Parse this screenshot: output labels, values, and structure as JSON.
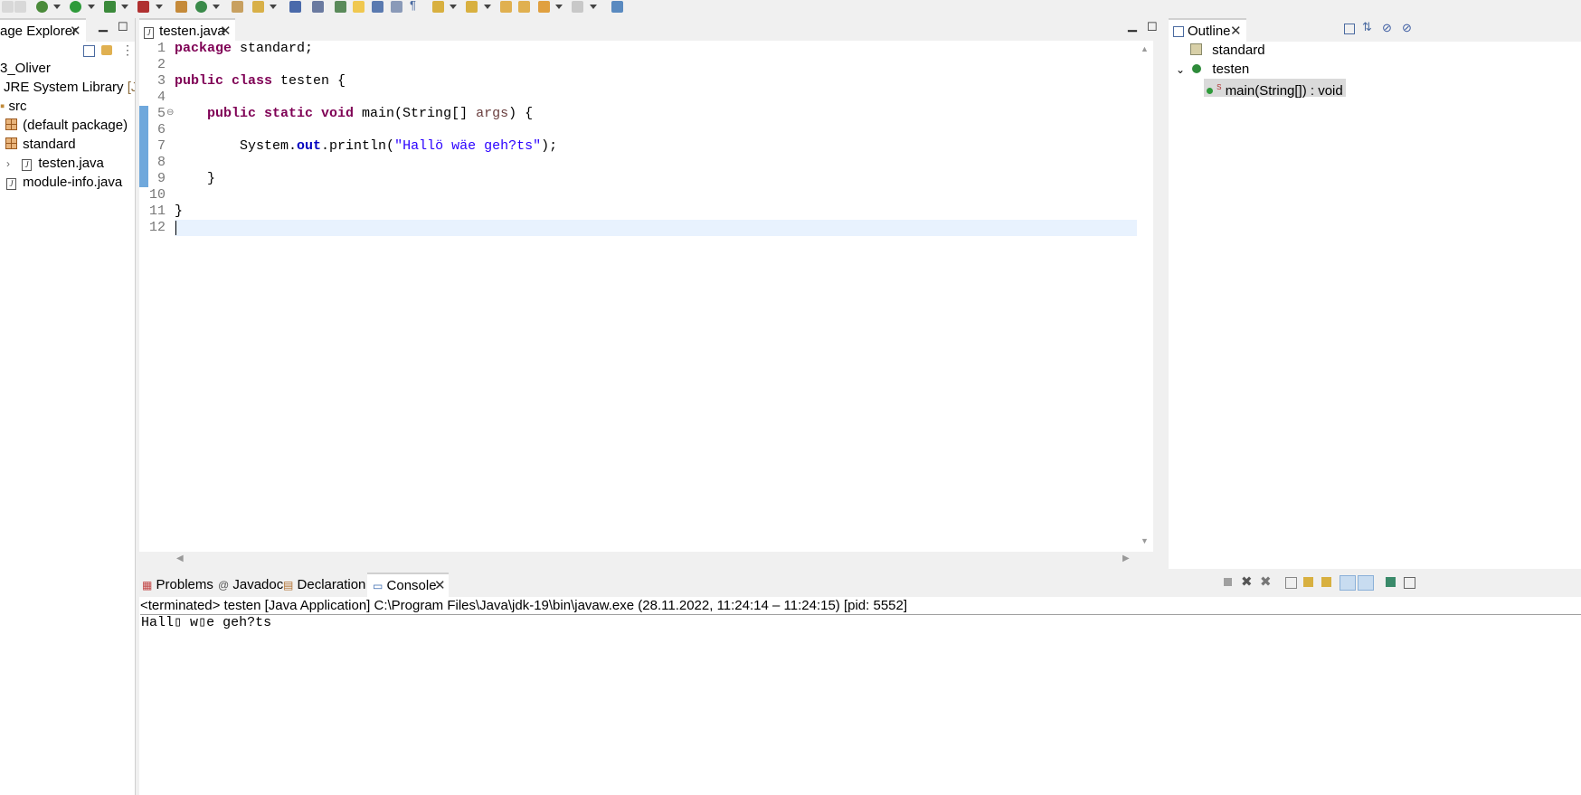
{
  "package_explorer": {
    "tab_label": "age Explorer",
    "items": [
      {
        "label": "3_Oliver"
      },
      {
        "label": "JRE System Library",
        "suffix": "[Java"
      },
      {
        "label": "src"
      },
      {
        "label": "(default package)"
      },
      {
        "label": "standard"
      },
      {
        "label": "testen.java"
      },
      {
        "label": "module-info.java"
      }
    ]
  },
  "editor": {
    "tab_label": "testen.java",
    "line_numbers": [
      "1",
      "2",
      "3",
      "4",
      "5",
      "6",
      "7",
      "8",
      "9",
      "10",
      "11",
      "12"
    ],
    "code": {
      "l1_kw": "package",
      "l1_rest": " standard;",
      "l3_kw": "public class",
      "l3_rest": " testen {",
      "l5_indent": "    ",
      "l5_kw": "public static void",
      "l5_mid": " main(String[] ",
      "l5_param": "args",
      "l5_end": ") {",
      "l7_pre": "        System.",
      "l7_field": "out",
      "l7_mid": ".println(",
      "l7_str": "\"Hallö wäe geh?ts\"",
      "l7_end": ");",
      "l9": "    }",
      "l11": "}"
    }
  },
  "outline": {
    "tab_label": "Outline",
    "items": [
      {
        "label": "standard"
      },
      {
        "label": "testen"
      },
      {
        "label": "main(String[]) : void",
        "badge": "S"
      }
    ]
  },
  "bottom": {
    "tabs": [
      {
        "label": "Problems"
      },
      {
        "label": "Javadoc"
      },
      {
        "label": "Declaration"
      },
      {
        "label": "Console"
      }
    ],
    "console_status": "<terminated> testen [Java Application] C:\\Program Files\\Java\\jdk-19\\bin\\javaw.exe  (28.11.2022, 11:24:14 – 11:24:15) [pid: 5552]",
    "console_output": "Hall▯ w▯e geh?ts"
  },
  "colors": {
    "keyword": "#7f0055",
    "string": "#2a00ff",
    "current_line": "#e8f2fe",
    "change_bar": "#6fa8dc"
  }
}
